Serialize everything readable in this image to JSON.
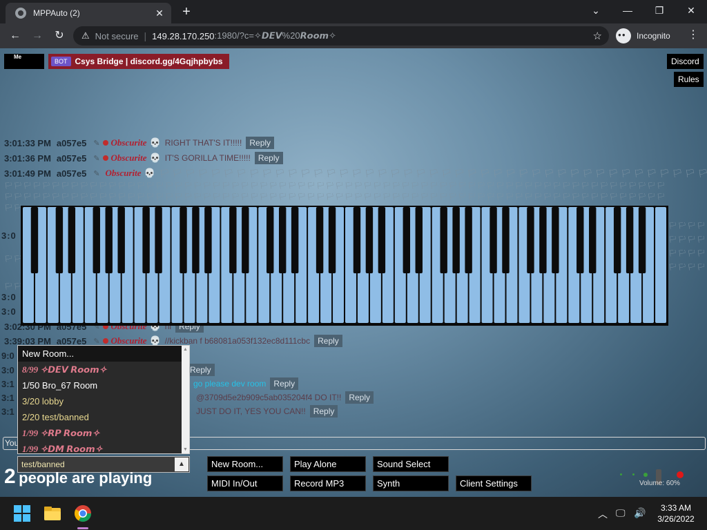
{
  "browser": {
    "tab_title": "MPPAuto (2)",
    "tab_close": "✕",
    "new_tab": "+",
    "win_min": "—",
    "win_max": "❐",
    "win_close": "✕",
    "collapse": "⌄",
    "not_secure": "Not secure",
    "url_host": "149.28.170.250",
    "url_rest": ":1980/?c=✧𝘿𝙀𝙑%20𝙍𝙤𝙤𝙢✧",
    "incognito": "Incognito",
    "back": "←",
    "forward": "→",
    "reload": "↻",
    "star": "☆",
    "kebab": "⋮",
    "warn": "⚠",
    "sep": "|"
  },
  "header": {
    "me_label": "Me",
    "me_name": "",
    "bot_tag": "BOT",
    "bot_name": "Csys Bridge | discord.gg/4Gqjhpbybs",
    "discord": "Discord",
    "rules": "Rules"
  },
  "chat": {
    "reply_label": "Reply",
    "nick": "Obscurite",
    "uid": "a057e5",
    "skull": "💀",
    "lines": [
      {
        "time": "3:01:33 PM",
        "msg": "RIGHT THAT'S IT!!!!!"
      },
      {
        "time": "3:01:36 PM",
        "msg": "IT'S GORILLA TIME!!!!!"
      },
      {
        "time": "3:01:49 PM",
        "msg": "🏳 🏳 🏳 🏳 🏳 🏳 🏳 🏳 🏳 🏳 🏳 🏳 🏳 🏳 🏳 🏳 🏳 🏳 🏳 🏳 🏳 🏳 🏳 🏳 🏳 🏳 🏳 🏳 🏳 🏳 🏳 🏳 🏳 🏳 🏳 🏳 🏳 🏳 🏳 🏳 🏳 🏳 🏳 🏳 🏳 🏳 🏳 🏳 🏳 🏳"
      },
      {
        "time": "3:02:30 PM",
        "msg": "hi"
      },
      {
        "time": "3:39:03 PM",
        "msg": "//kickban f b68081a053f132ec8d111cbc"
      }
    ],
    "partial_times": [
      "3:0",
      "3:0",
      "3:0",
      "9:0",
      "3:0",
      "3:1",
      "3:1",
      "3:1"
    ],
    "partial_msgs": [
      "go please dev room",
      "@3709d5e2b909c5ab035204f4 DO IT!!",
      "JUST DO IT, YES YOU CAN!!"
    ],
    "input_label": "You"
  },
  "rooms": {
    "items": [
      {
        "label": "New Room...",
        "style": "newroom"
      },
      {
        "label": "8/99 ✧𝘿𝙀𝙑 𝙍𝙤𝙤𝙢✧",
        "style": "pink"
      },
      {
        "label": "1/50 Bro_67 Room",
        "style": "white"
      },
      {
        "label": "3/20 lobby",
        "style": "gold"
      },
      {
        "label": "2/20 test/banned",
        "style": "gold"
      },
      {
        "label": "1/99 ✧𝙍𝙋 𝙍𝙤𝙤𝙢✧",
        "style": "pink"
      },
      {
        "label": "1/99 ✧𝘿𝙈 𝙍𝙤𝙤𝙢✧",
        "style": "pink"
      }
    ],
    "selected": "test/banned",
    "arrow": "▲",
    "scroll_up": "▲",
    "scroll_down": "▼"
  },
  "status": {
    "count": "2",
    "text": "people are playing"
  },
  "controls": {
    "new_room": "New Room...",
    "play_alone": "Play Alone",
    "sound_select": "Sound Select",
    "midi": "MIDI In/Out",
    "record": "Record MP3",
    "synth": "Synth",
    "client_settings": "Client Settings",
    "volume": "Volume: 60%"
  },
  "taskbar": {
    "time": "3:33 AM",
    "date": "3/26/2022",
    "chevron": "︿",
    "tray_icons": [
      "🖵",
      "🔊"
    ]
  },
  "colors": {
    "piano_white": "#8fbde6",
    "piano_black": "#0c0c0c",
    "nick": "#b22030",
    "accent_cyan": "#26c1e6"
  }
}
